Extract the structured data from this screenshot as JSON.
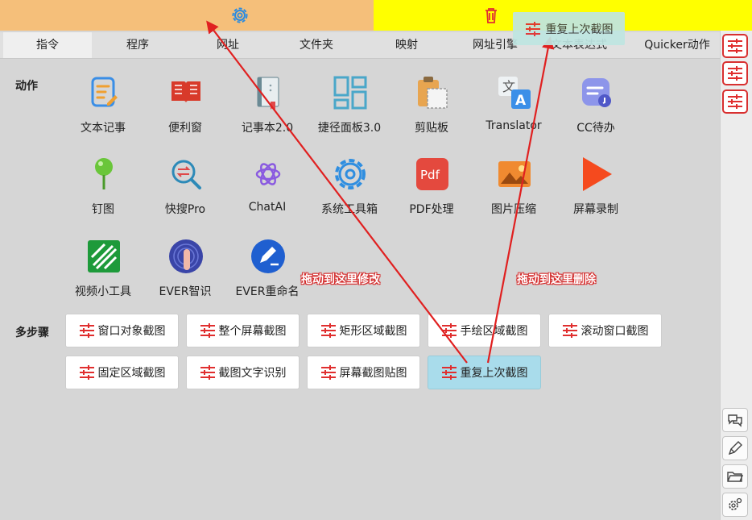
{
  "drop_zones": {
    "edit_icon": "gear-icon",
    "delete_icon": "trash-icon"
  },
  "drag_preview": {
    "label": "重复上次截图"
  },
  "tabs": [
    "指令",
    "程序",
    "网址",
    "文件夹",
    "映射",
    "网址引擎",
    "文本表达式",
    "Quicker动作"
  ],
  "sections": {
    "actions": "动作",
    "steps": "多步骤"
  },
  "actions": [
    {
      "label": "文本记事",
      "icon": "note-icon"
    },
    {
      "label": "便利窗",
      "icon": "book-icon"
    },
    {
      "label": "记事本2.0",
      "icon": "notebook-icon"
    },
    {
      "label": "捷径面板3.0",
      "icon": "panel-icon"
    },
    {
      "label": "剪贴板",
      "icon": "clipboard-icon"
    },
    {
      "label": "Translator",
      "icon": "translate-icon"
    },
    {
      "label": "CC待办",
      "icon": "todo-icon"
    },
    {
      "label": "钉图",
      "icon": "pin-icon"
    },
    {
      "label": "快搜Pro",
      "icon": "search-icon"
    },
    {
      "label": "ChatAI",
      "icon": "chatai-icon"
    },
    {
      "label": "系统工具箱",
      "icon": "gear-icon"
    },
    {
      "label": "PDF处理",
      "icon": "pdf-icon"
    },
    {
      "label": "图片压缩",
      "icon": "image-icon"
    },
    {
      "label": "屏幕录制",
      "icon": "play-icon"
    },
    {
      "label": "视频小工具",
      "icon": "video-icon"
    },
    {
      "label": "EVER智识",
      "icon": "fingerprint-icon"
    },
    {
      "label": "EVER重命名",
      "icon": "rename-icon"
    }
  ],
  "steps": [
    {
      "label": "窗口对象截图"
    },
    {
      "label": "整个屏幕截图"
    },
    {
      "label": "矩形区域截图"
    },
    {
      "label": "手绘区域截图"
    },
    {
      "label": "滚动窗口截图"
    },
    {
      "label": "固定区域截图"
    },
    {
      "label": "截图文字识别"
    },
    {
      "label": "屏幕截图贴图"
    },
    {
      "label": "重复上次截图"
    }
  ],
  "annotations": {
    "edit": "拖动到这里修改",
    "delete": "拖动到这里删除"
  },
  "rail_icons": [
    "sliders-icon",
    "sliders-icon",
    "sliders-icon",
    "chat-icon",
    "pen-icon",
    "folder-icon",
    "settings-icon"
  ],
  "colors": {
    "accent_red": "#e02e2e",
    "edit_zone": "#f5bf7a",
    "delete_zone": "#ffff00",
    "highlight": "#a9dceb"
  }
}
